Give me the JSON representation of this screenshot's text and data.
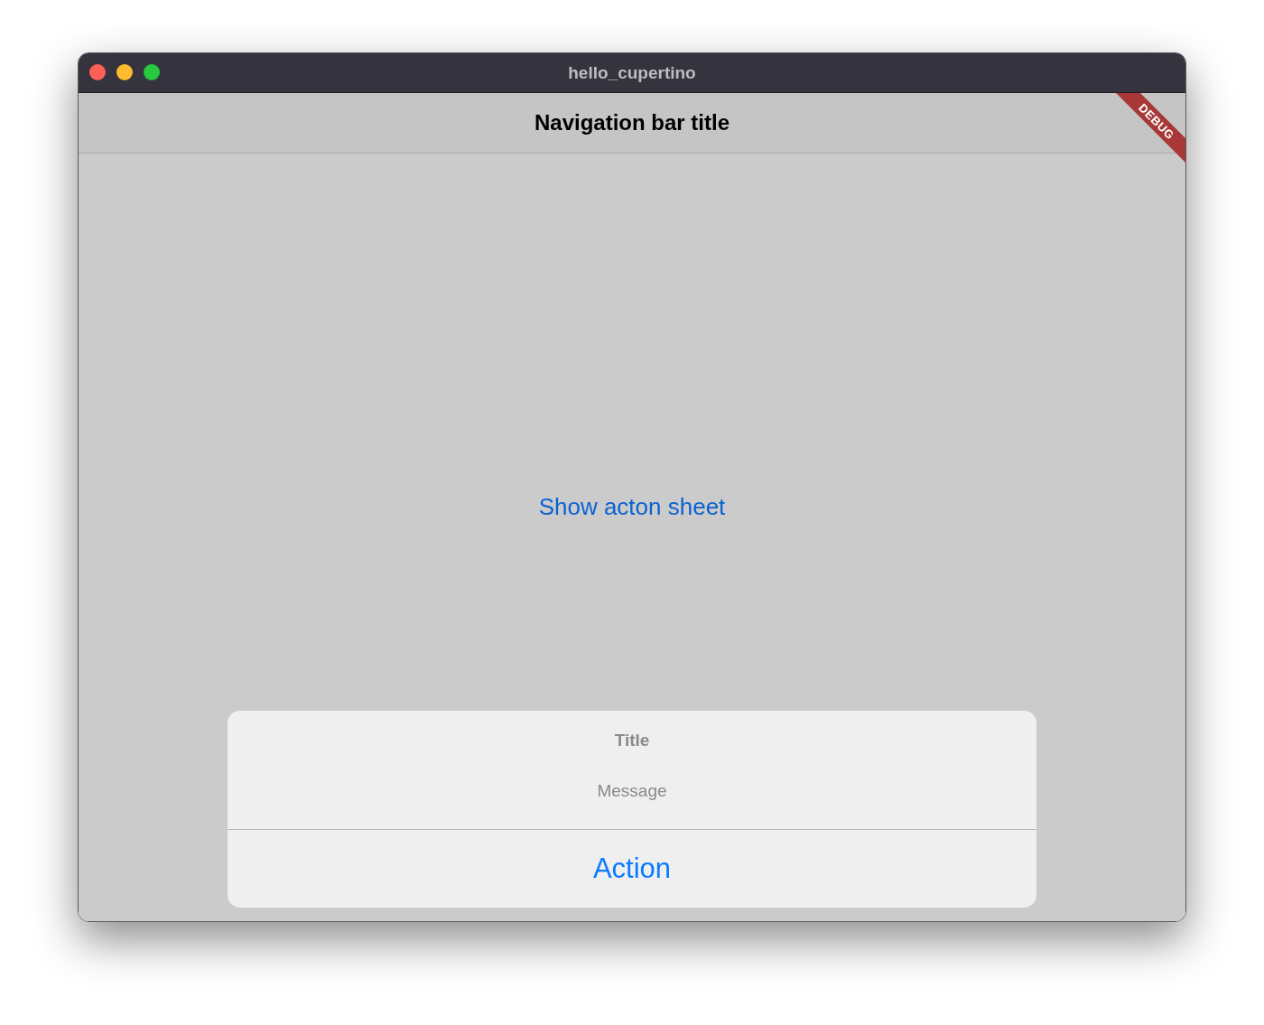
{
  "window": {
    "title": "hello_cupertino"
  },
  "nav_bar": {
    "title": "Navigation bar title"
  },
  "debug_banner": {
    "label": "DEBUG"
  },
  "show_button": {
    "label": "Show acton sheet"
  },
  "action_sheet": {
    "title": "Title",
    "message": "Message",
    "actions": [
      {
        "label": "Action"
      }
    ]
  }
}
